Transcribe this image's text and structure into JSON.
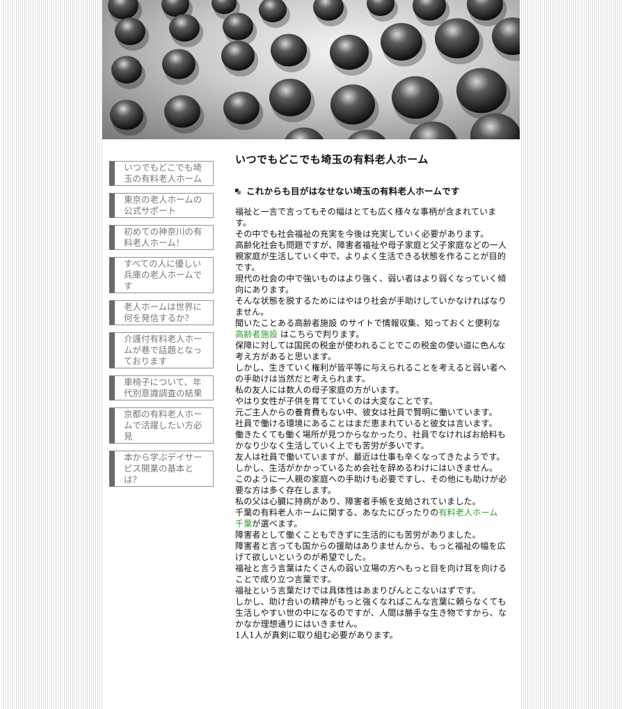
{
  "header": {
    "image_icon": "textured-dots-image"
  },
  "sidebar": {
    "items": [
      {
        "label": "いつでもどこでも埼玉の有料老人ホーム"
      },
      {
        "label": "東京の老人ホームの公式サポート"
      },
      {
        "label": "初めての神奈川の有料老人ホーム！"
      },
      {
        "label": "すべての人に優しい兵庫の老人ホームです"
      },
      {
        "label": "老人ホームは世界に何を発信するか？"
      },
      {
        "label": "介護付有料老人ホームが巷で話題となっております"
      },
      {
        "label": "車椅子について、年代別意識調査の結果"
      },
      {
        "label": "京都の有料老人ホームで活躍したい方必見"
      },
      {
        "label": "本から学ぶデイサービス開業の基本とは？"
      }
    ]
  },
  "main": {
    "title": "いつでもどこでも埼玉の有料老人ホーム",
    "subtitle": "これからも目がはなせない埼玉の有料老人ホームです",
    "paragraphs": [
      "福祉と一言で言ってもその幅はとても広く様々な事柄が含まれています。",
      "その中でも社会福祉の充実を今後は充実していく必要があります。",
      "高齢化社会も問題ですが、障害者福祉や母子家庭と父子家庭などの一人親家庭が生活していく中で、よりよく生活できる状態を作ることが目的です。",
      "現代の社会の中で強いものはより強く、弱い者はより弱くなっていく傾向にあります。",
      "そんな状態を脱するためにはやはり社会が手助けしていかなければなりません。",
      "保障に対しては国民の税金が使われることでこの税金の使い道に色んな考え方があると思います。",
      "しかし、生きていく権利が皆平等に与えられることを考えると弱い者への手助けは当然だと考えられます。",
      "私の友人には数人の母子家庭の方がいます。",
      "やはり女性が子供を育てていくのは大変なことです。",
      "元ご主人からの養育費もない中、彼女は社員で賢明に働いています。",
      "社員で働ける環境にあることはまだ恵まれていると彼女は言います。",
      "働きたくても働く場所が見つからなかったり、社員でなければお給料もかなり少なく生活していく上でも苦労が多いです。",
      "友人は社員で働いていますが、最近は仕事も辛くなってきたようです。",
      "しかし、生活がかかっているため会社を辞めるわけにはいきません。",
      "このように一人親の家庭への手助けも必要ですし、その他にも助けが必要な方は多く存在します。",
      "私の父は心臓に持病があり、障害者手帳を支給されていました。",
      "障害者として働くこともできずに生活的にも苦労がありました。",
      "障害者と言っても国からの援助はありませんから、もっと福祉の幅を広げて欲しいというのが希望でした。",
      "福祉と言う言葉はたくさんの弱い立場の方へもっと目を向け耳を向けることで成り立つ言葉です。",
      "福祉という言葉だけでは具体性はあまりぴんとこないはずです。",
      "しかし、助け合いの精神がもっと強くなればこんな言葉に頼らなくても生活しやすい世の中になるのですが、人間は勝手な生き物ですから、なかなか理想通りにはいきません。",
      "1人1人が真剣に取り組む必要があります。"
    ],
    "link_para_1": {
      "pre": "聞いたことある高齢者施設 のサイトで情報収集、知っておくと便利な",
      "link": "高齢者施設",
      "post": " はこちらで判ります。"
    },
    "link_para_2": {
      "pre": "千葉の有料老人ホームに関する、あなたにぴったりの",
      "link": "有料老人ホーム 千葉",
      "post": "が選べます。"
    },
    "link_color": "#2e9a2e"
  }
}
